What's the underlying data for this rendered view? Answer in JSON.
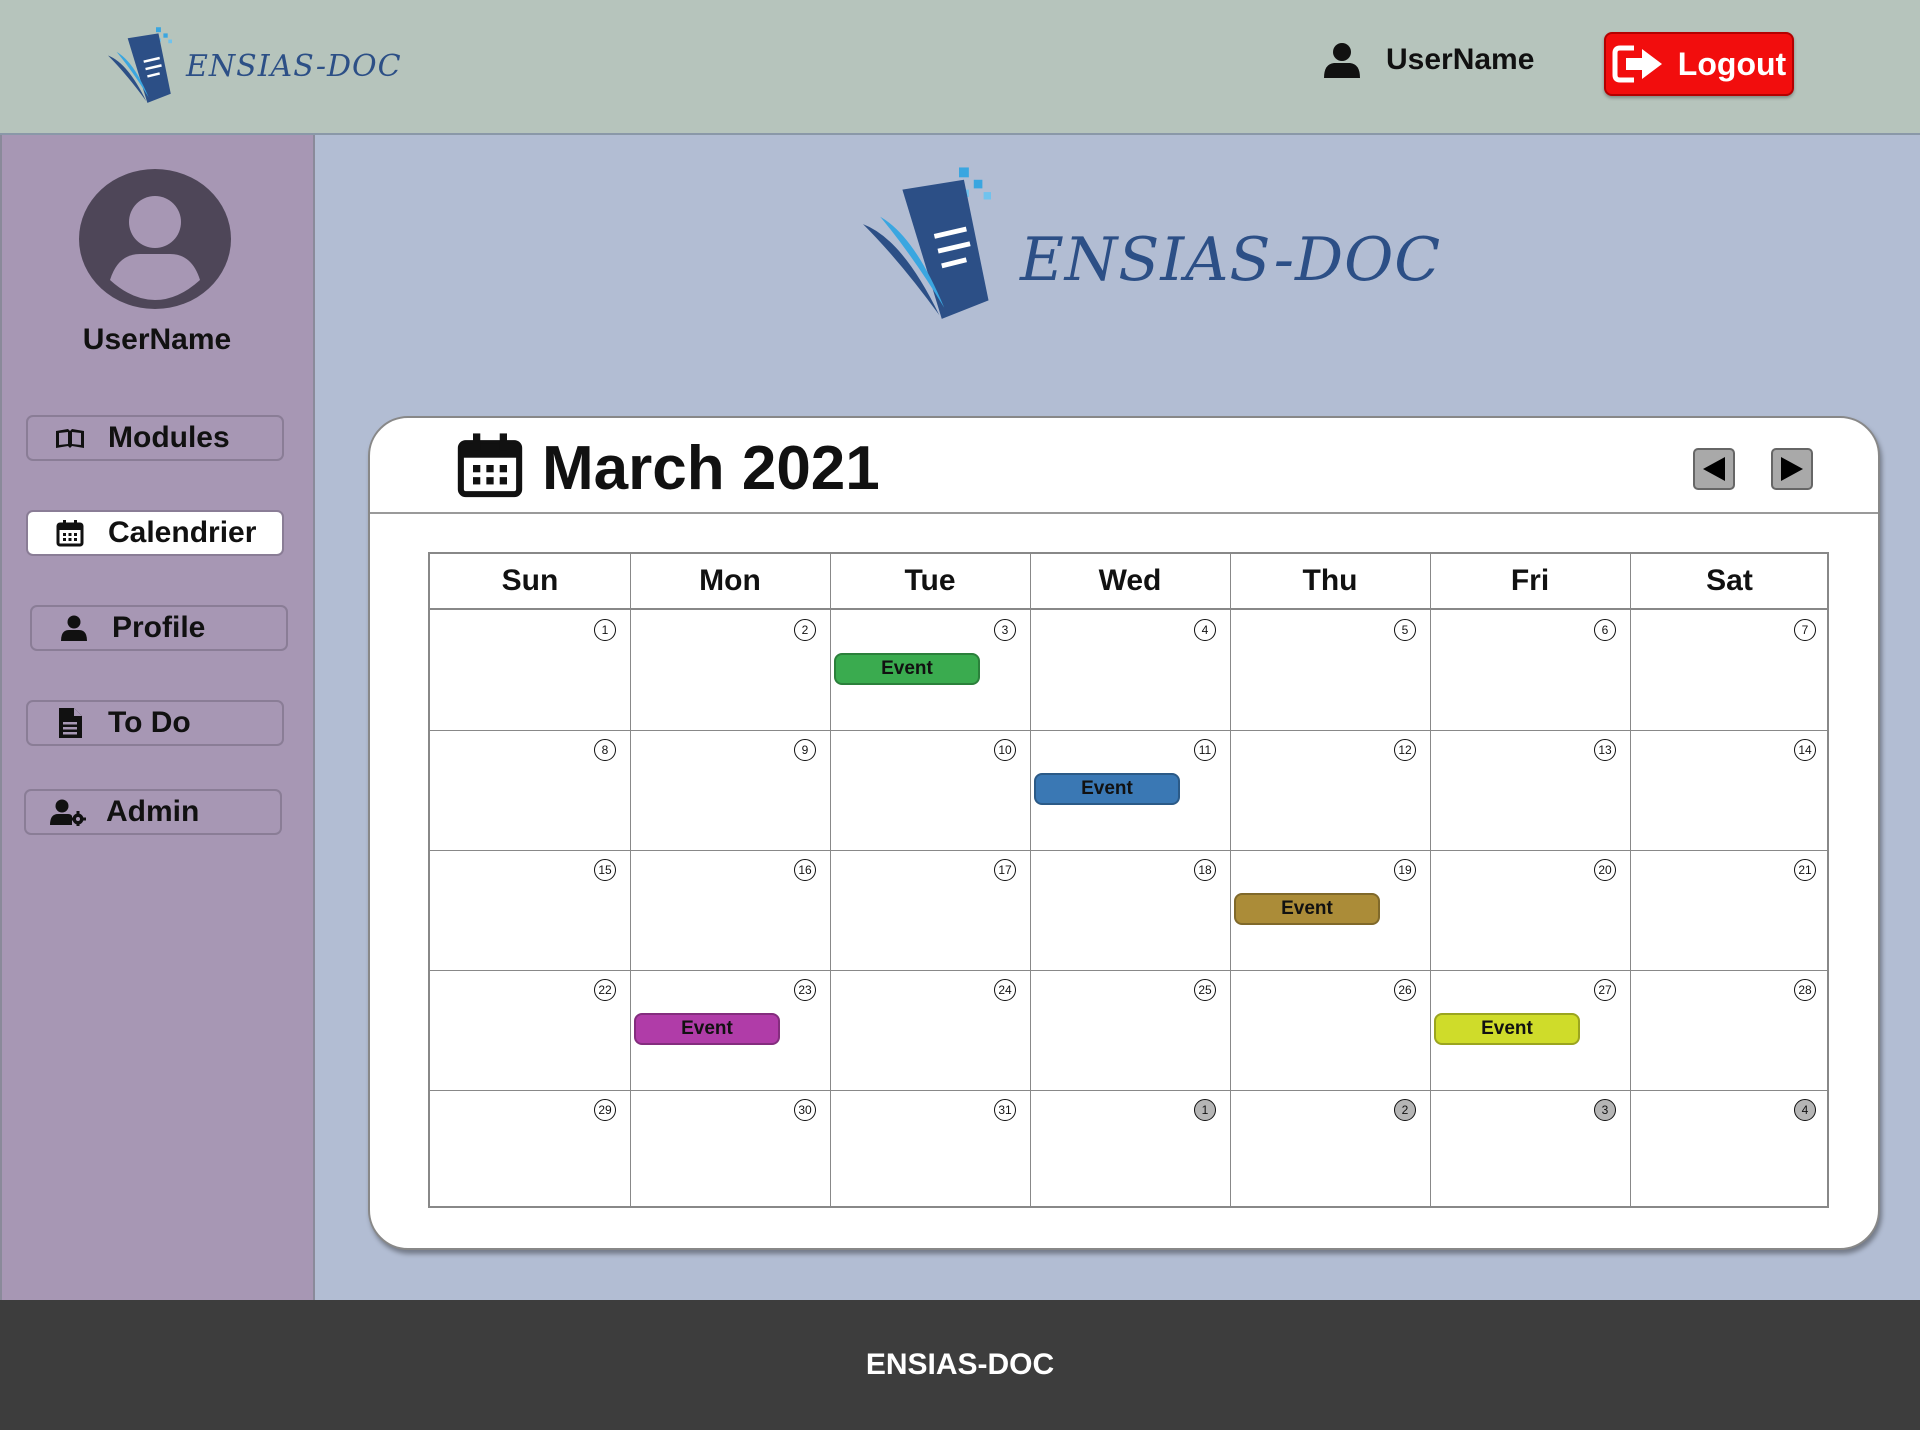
{
  "header": {
    "brand": "ENSIAS-DOC",
    "username": "UserName",
    "logout_label": "Logout"
  },
  "sidebar": {
    "username": "UserName",
    "items": [
      {
        "label": "Modules",
        "icon": "book-icon",
        "active": false
      },
      {
        "label": "Calendrier",
        "icon": "calendar-icon",
        "active": true
      },
      {
        "label": "Profile",
        "icon": "user-icon",
        "active": false
      },
      {
        "label": "To Do",
        "icon": "document-icon",
        "active": false
      },
      {
        "label": "Admin",
        "icon": "user-gear-icon",
        "active": false
      }
    ]
  },
  "main": {
    "brand": "ENSIAS-DOC"
  },
  "calendar": {
    "title": "March 2021",
    "weekdays": [
      "Sun",
      "Mon",
      "Tue",
      "Wed",
      "Thu",
      "Fri",
      "Sat"
    ],
    "weeks": [
      [
        "1",
        "2",
        "3",
        "4",
        "5",
        "6",
        "7"
      ],
      [
        "8",
        "9",
        "10",
        "11",
        "12",
        "13",
        "14"
      ],
      [
        "15",
        "16",
        "17",
        "18",
        "19",
        "20",
        "21"
      ],
      [
        "22",
        "23",
        "24",
        "25",
        "26",
        "27",
        "28"
      ],
      [
        "29",
        "30",
        "31",
        "1",
        "2",
        "3",
        "4"
      ]
    ],
    "next_month_days": [
      "1",
      "2",
      "3",
      "4"
    ],
    "events": [
      {
        "day": "3",
        "label": "Event",
        "color": "#3aab4f"
      },
      {
        "day": "11",
        "label": "Event",
        "color": "#3a78b4"
      },
      {
        "day": "19",
        "label": "Event",
        "color": "#ab8c38"
      },
      {
        "day": "23",
        "label": "Event",
        "color": "#b03ca8"
      },
      {
        "day": "27",
        "label": "Event",
        "color": "#cfdc2a"
      }
    ]
  },
  "footer": {
    "text": "ENSIAS-DOC"
  },
  "colors": {
    "topbar": "#b6c4bc",
    "sidebar": "#a797b4",
    "main_bg": "#b2bdd3",
    "logout": "#f20d0d",
    "footer": "#3d3d3d",
    "brand_blue": "#2c4f86"
  }
}
